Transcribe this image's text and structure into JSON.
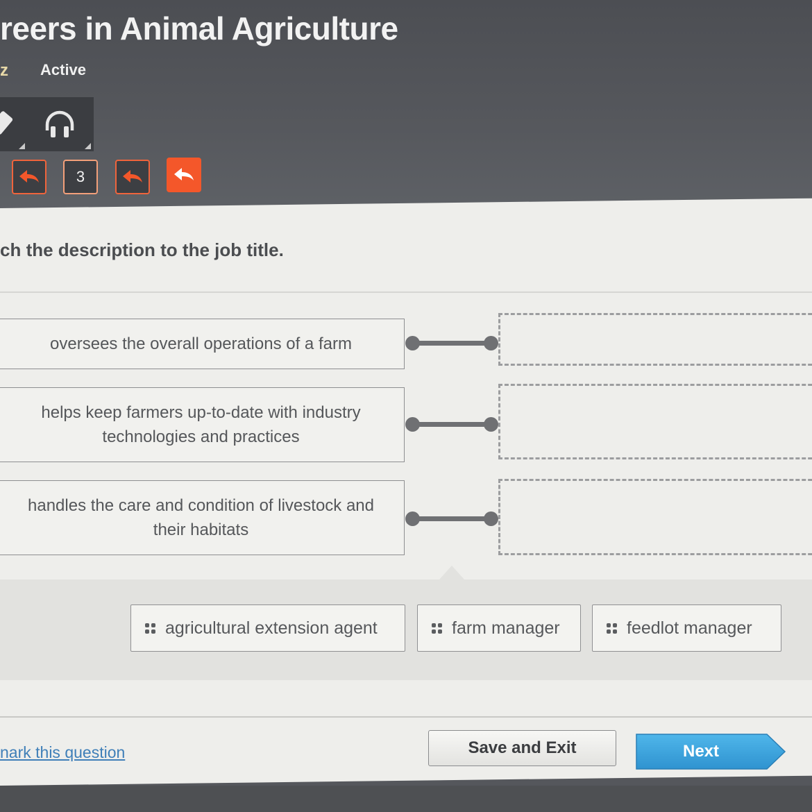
{
  "header": {
    "course_title": "reers in Animal Agriculture",
    "activity_type": "z",
    "status": "Active"
  },
  "toolbar": {
    "tools": [
      {
        "name": "pencil-icon"
      },
      {
        "name": "headphones-icon"
      }
    ]
  },
  "navigation": {
    "current_question": "3",
    "buttons": [
      "back",
      "question-number",
      "previous",
      "return"
    ]
  },
  "question": {
    "prompt": "ch the description to the job title.",
    "descriptions": [
      {
        "text": "oversees the overall operations of a farm"
      },
      {
        "text": "helps keep farmers up-to-date with industry technologies and practices"
      },
      {
        "text": "handles the care and condition of livestock and their habitats"
      }
    ],
    "answer_choices": [
      {
        "label": "agricultural extension agent"
      },
      {
        "label": "farm manager"
      },
      {
        "label": "feedlot manager"
      }
    ]
  },
  "footer": {
    "mark_link": "nark this question",
    "save_label": "Save and Exit",
    "next_label": "Next"
  },
  "colors": {
    "accent_orange": "#f4572a",
    "next_blue": "#3ea6de",
    "link_blue": "#3f7fb8"
  }
}
